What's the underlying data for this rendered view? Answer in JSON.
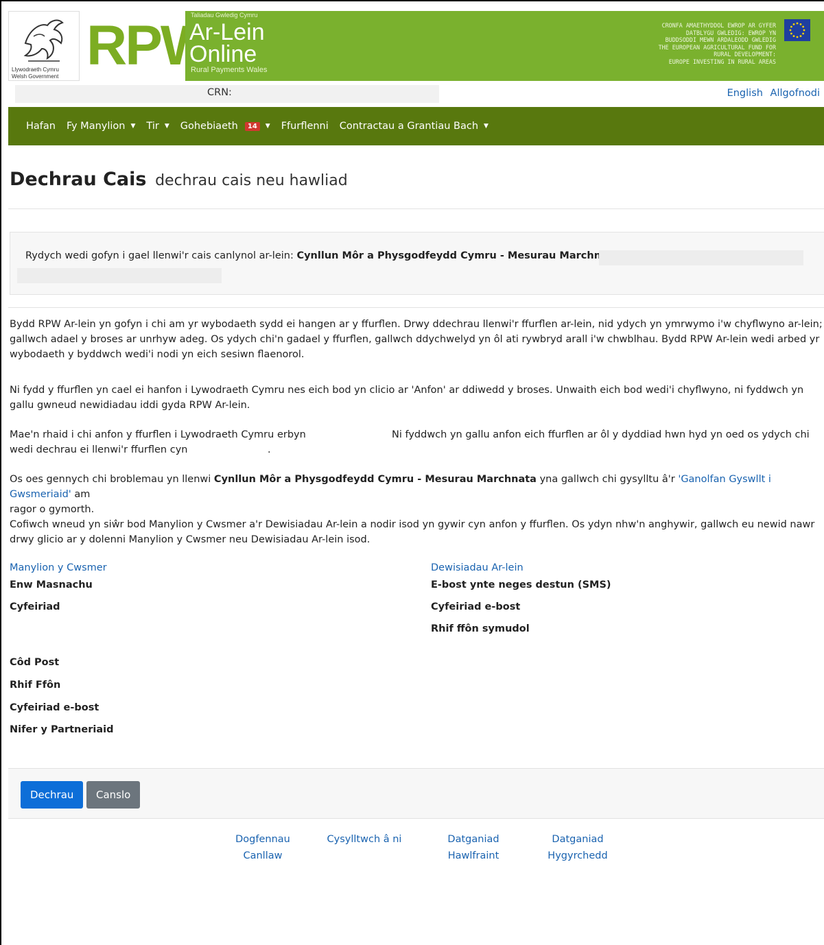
{
  "header": {
    "gov_logo_line1": "Llywodraeth Cymru",
    "gov_logo_line2": "Welsh Government",
    "rpw": "RPW",
    "tagline": "Taliadau Gwledig Cymru",
    "ar_lein": "Ar-Lein",
    "online": "Online",
    "rural_payments": "Rural Payments Wales",
    "eu_text": [
      "CRONFA AMAETHYDDOL EWROP AR GYFER",
      "DATBLYGU GWLEDIG: EWROP YN",
      "BUDDSODDI MEWN ARDALEODD GWLEDIG",
      "THE EUROPEAN AGRICULTURAL FUND FOR",
      "RURAL DEVELOPMENT:",
      "EUROPE INVESTING IN RURAL AREAS"
    ],
    "brand_green": "#7ab12e"
  },
  "topbar": {
    "crn_label": "CRN:",
    "english": "English",
    "logout": "Allgofnodi"
  },
  "nav": {
    "color": "#58780e",
    "items": [
      {
        "label": "Hafan"
      },
      {
        "label": "Fy Manylion"
      },
      {
        "label": "Tir"
      },
      {
        "label": "Gohebiaeth",
        "badge": "14"
      },
      {
        "label": "Ffurflenni"
      },
      {
        "label": "Contractau a Grantiau Bach"
      }
    ]
  },
  "title": {
    "main": "Dechrau Cais",
    "sub": "dechrau cais neu hawliad"
  },
  "info": {
    "prefix": "Rydych wedi gofyn i gael llenwi'r cais canlynol ar-lein: ",
    "scheme": "Cynllun Môr a Physgodfeydd Cymru - Mesurau Marchnata"
  },
  "paras": {
    "p1": "Bydd RPW Ar-lein yn gofyn i chi am yr wybodaeth sydd ei hangen ar y ffurflen. Drwy ddechrau llenwi'r ffurflen ar-lein, nid ydych yn ymrwymo i'w chyflwyno ar-lein; gallwch adael y broses ar unrhyw adeg. Os ydych chi'n gadael y ffurflen, gallwch ddychwelyd yn ôl ati rywbryd arall i'w chwblhau. Bydd RPW Ar-lein wedi arbed yr wybodaeth y byddwch wedi'i nodi yn eich sesiwn flaenorol.",
    "p2": "Ni fydd y ffurflen yn cael ei hanfon i Lywodraeth Cymru nes eich bod yn clicio ar 'Anfon' ar ddiwedd y broses. Unwaith eich bod wedi'i chyflwyno, ni fyddwch yn gallu gwneud newidiadau iddi gyda RPW Ar-lein.",
    "p3a": "Mae'n rhaid i chi anfon y ffurflen i Lywodraeth Cymru erbyn",
    "p3b": "Ni fyddwch yn gallu anfon eich ffurflen ar ôl y dyddiad hwn hyd yn oed os ydych chi",
    "p3c": "wedi dechrau ei llenwi'r ffurflen cyn",
    "p3d": ".",
    "p4a": "Os oes gennych chi broblemau yn llenwi ",
    "p4b": "Cynllun Môr a Physgodfeydd Cymru - Mesurau Marchnata",
    "p4c": " yna gallwch chi gysylltu â'r ",
    "p4link": "'Ganolfan Gyswllt i Gwsmeriaid'",
    "p4d": " am",
    "p4e": "ragor o gymorth.",
    "p5": "Cofiwch wneud yn siŵr bod Manylion y Cwsmer a'r Dewisiadau Ar-lein a nodir isod yn gywir cyn anfon y ffurflen. Os ydyn nhw'n anghywir, gallwch eu newid nawr drwy glicio ar y dolenni Manylion y Cwsmer neu Dewisiadau Ar-lein isod."
  },
  "customer": {
    "heading": "Manylion y Cwsmer",
    "trading_name": "Enw Masnachu",
    "address": "Cyfeiriad",
    "postcode": "Côd Post",
    "phone": "Rhif Ffôn",
    "email": "Cyfeiriad e-bost",
    "partners": "Nifer y Partneriaid"
  },
  "online_prefs": {
    "heading": "Dewisiadau Ar-lein",
    "channel": "E-bost ynte neges destun (SMS)",
    "email": "Cyfeiriad e-bost",
    "mobile": "Rhif ffôn symudol"
  },
  "buttons": {
    "start": "Dechrau",
    "cancel": "Canslo"
  },
  "footer": {
    "guidance_1": "Dogfennau",
    "guidance_2": "Canllaw",
    "contact": "Cysylltwch â ni",
    "copyright_1": "Datganiad",
    "copyright_2": "Hawlfraint",
    "accessibility_1": "Datganiad",
    "accessibility_2": "Hygyrchedd"
  }
}
